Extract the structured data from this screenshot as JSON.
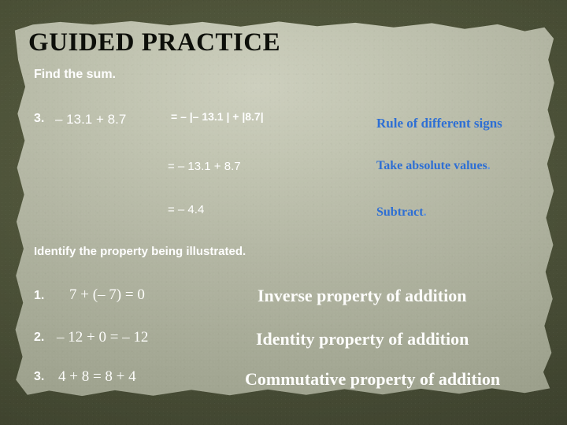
{
  "slide": {
    "title": "GUIDED PRACTICE",
    "colors": {
      "title_text": "#0d0f0a",
      "body_text": "#ffffff",
      "accent_blue": "#2e6fd4",
      "paper": "#b2b5a2",
      "frame": "#4b5137"
    }
  },
  "section_one": {
    "instruction": "Find the sum.",
    "problem": {
      "number": "3.",
      "expression": "– 13.1 +  8.7"
    },
    "steps": [
      {
        "work": "= – |– 13.1 | + |8.7|",
        "reason": "Rule of different signs",
        "reason_dot": ""
      },
      {
        "work": "= – 13.1 + 8.7",
        "reason": "Take absolute values",
        "reason_dot": "."
      },
      {
        "work": "= – 4.4",
        "reason": "Subtract",
        "reason_dot": "."
      }
    ]
  },
  "section_two": {
    "instruction": "Identify the property being illustrated.",
    "items": [
      {
        "number": "1.",
        "expression": "7 + (– 7) = 0",
        "answer": "Inverse property of addition"
      },
      {
        "number": "2.",
        "expression": "– 12 + 0  = – 12",
        "answer": "Identity property of addition"
      },
      {
        "number": "3.",
        "expression": "4 + 8  = 8 + 4",
        "answer": "Commutative property of addition"
      }
    ]
  }
}
